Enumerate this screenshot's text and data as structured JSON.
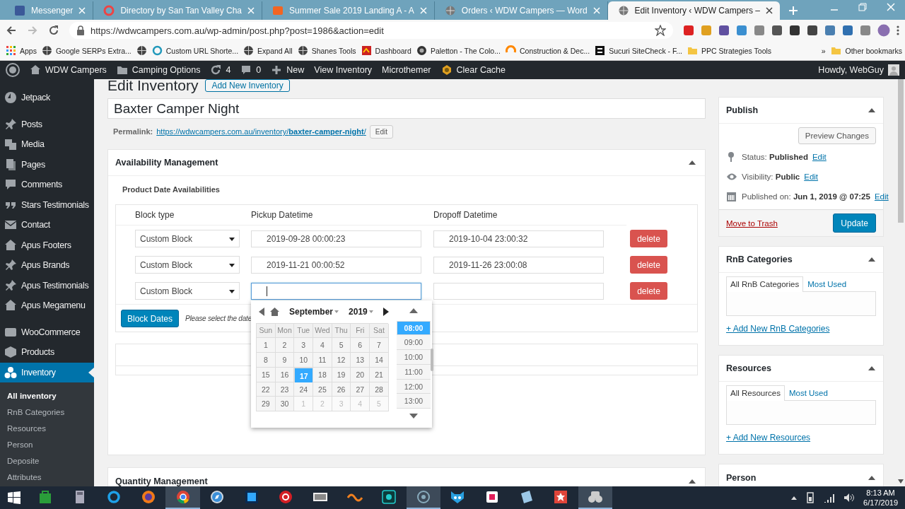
{
  "browser": {
    "tabs": [
      {
        "title": "Messenger",
        "selected": false
      },
      {
        "title": "Directory by San Tan Valley Cha",
        "selected": false
      },
      {
        "title": "Summer Sale 2019 Landing A - A",
        "selected": false
      },
      {
        "title": "Orders ‹ WDW Campers — Word",
        "selected": false
      },
      {
        "title": "Edit Inventory ‹ WDW Campers –",
        "selected": true
      }
    ],
    "url": "https://wdwcampers.com.au/wp-admin/post.php?post=1986&action=edit",
    "bookmarks": [
      {
        "kind": "link",
        "label": "Apps"
      },
      {
        "kind": "link",
        "label": "Google SERPs Extra..."
      },
      {
        "kind": "icon"
      },
      {
        "kind": "link",
        "label": "Custom URL Shorte..."
      },
      {
        "kind": "link",
        "label": "Expand All"
      },
      {
        "kind": "link",
        "label": "Shanes Tools"
      },
      {
        "kind": "link",
        "label": "Dashboard"
      },
      {
        "kind": "link",
        "label": "Paletton - The Colo..."
      },
      {
        "kind": "link",
        "label": "Construction & Dec..."
      },
      {
        "kind": "link",
        "label": "Sucuri SiteCheck - F..."
      },
      {
        "kind": "link",
        "label": "PPC Strategies Tools"
      }
    ],
    "more_bookmarks": "»",
    "other_bookmarks": "Other bookmarks"
  },
  "admin_bar": {
    "items": [
      "WDW Campers",
      "Camping Options",
      "4",
      "0",
      "New",
      "View Inventory",
      "Microthemer",
      "Clear Cache"
    ],
    "greeting": "Howdy, WebGuy"
  },
  "sidebar": {
    "menu_groups": [
      [
        {
          "label": "Jetpack",
          "selected": false
        }
      ],
      [
        {
          "label": "Posts",
          "selected": false
        },
        {
          "label": "Media",
          "selected": false
        },
        {
          "label": "Pages",
          "selected": false
        },
        {
          "label": "Comments",
          "selected": false
        },
        {
          "label": "Stars Testimonials",
          "selected": false
        },
        {
          "label": "Contact",
          "selected": false
        },
        {
          "label": "Apus Footers",
          "selected": false
        },
        {
          "label": "Apus Brands",
          "selected": false
        },
        {
          "label": "Apus Testimonials",
          "selected": false
        },
        {
          "label": "Apus Megamenu",
          "selected": false
        }
      ],
      [
        {
          "label": "WooCommerce",
          "selected": false
        },
        {
          "label": "Products",
          "selected": false
        },
        {
          "label": "Inventory",
          "selected": true
        }
      ]
    ],
    "submenu": [
      {
        "label": "All inventory",
        "selected": true
      },
      {
        "label": "RnB Categories",
        "selected": false
      },
      {
        "label": "Resources",
        "selected": false
      },
      {
        "label": "Person",
        "selected": false
      },
      {
        "label": "Deposite",
        "selected": false
      },
      {
        "label": "Attributes",
        "selected": false
      }
    ]
  },
  "editor": {
    "heading": "Edit Inventory",
    "add_new": "Add New Inventory",
    "title": "Baxter Camper Night",
    "permalink": {
      "label": "Permalink:",
      "url": "https://wdwcampers.com.au/inventory/**baxter-camper-night**/",
      "edit": "Edit"
    },
    "availability": {
      "title": "Availability Management",
      "subtitle": "Product Date Availabilities",
      "columns": [
        "Block type",
        "Pickup Datetime",
        "Dropoff Datetime"
      ],
      "rows": [
        {
          "block_type": "Custom Block",
          "pickup": "2019-09-28 00:00:23",
          "dropoff": "2019-10-04 23:00:32",
          "pickup_focused": false,
          "delete": "delete"
        },
        {
          "block_type": "Custom Block",
          "pickup": "2019-11-21 00:00:52",
          "dropoff": "2019-11-26 23:00:08",
          "pickup_focused": false,
          "delete": "delete"
        },
        {
          "block_type": "Custom Block",
          "pickup_focused": true,
          "delete": "delete"
        }
      ],
      "block_button": "Block Dates",
      "hint": "Please select the date",
      "datepicker": {
        "month": "September",
        "year": "2019",
        "weekdays": [
          "Sun",
          "Mon",
          "Tue",
          "Wed",
          "Thu",
          "Fri",
          "Sat"
        ],
        "weeks": [
          [
            {
              "day": "1",
              "selected": false,
              "other_month": false
            },
            {
              "day": "2",
              "selected": false,
              "other_month": false
            },
            {
              "day": "3",
              "selected": false,
              "other_month": false
            },
            {
              "day": "4",
              "selected": false,
              "other_month": false
            },
            {
              "day": "5",
              "selected": false,
              "other_month": false
            },
            {
              "day": "6",
              "selected": false,
              "other_month": false
            },
            {
              "day": "7",
              "selected": false,
              "other_month": false
            }
          ],
          [
            {
              "day": "8",
              "selected": false,
              "other_month": false
            },
            {
              "day": "9",
              "selected": false,
              "other_month": false
            },
            {
              "day": "10",
              "selected": false,
              "other_month": false
            },
            {
              "day": "11",
              "selected": false,
              "other_month": false
            },
            {
              "day": "12",
              "selected": false,
              "other_month": false
            },
            {
              "day": "13",
              "selected": false,
              "other_month": false
            },
            {
              "day": "14",
              "selected": false,
              "other_month": false
            }
          ],
          [
            {
              "day": "15",
              "selected": false,
              "other_month": false
            },
            {
              "day": "16",
              "selected": false,
              "other_month": false
            },
            {
              "day": "17",
              "selected": true,
              "other_month": false
            },
            {
              "day": "18",
              "selected": false,
              "other_month": false
            },
            {
              "day": "19",
              "selected": false,
              "other_month": false
            },
            {
              "day": "20",
              "selected": false,
              "other_month": false
            },
            {
              "day": "21",
              "selected": false,
              "other_month": false
            }
          ],
          [
            {
              "day": "22",
              "selected": false,
              "other_month": false
            },
            {
              "day": "23",
              "selected": false,
              "other_month": false
            },
            {
              "day": "24",
              "selected": false,
              "other_month": false
            },
            {
              "day": "25",
              "selected": false,
              "other_month": false
            },
            {
              "day": "26",
              "selected": false,
              "other_month": false
            },
            {
              "day": "27",
              "selected": false,
              "other_month": false
            },
            {
              "day": "28",
              "selected": false,
              "other_month": false
            }
          ],
          [
            {
              "day": "29",
              "selected": false,
              "other_month": false
            },
            {
              "day": "30",
              "selected": false,
              "other_month": false
            },
            {
              "day": "1",
              "selected": false,
              "other_month": true
            },
            {
              "day": "2",
              "selected": false,
              "other_month": true
            },
            {
              "day": "3",
              "selected": false,
              "other_month": true
            },
            {
              "day": "4",
              "selected": false,
              "other_month": true
            },
            {
              "day": "5",
              "selected": false,
              "other_month": true
            }
          ]
        ],
        "times": [
          {
            "label": "08:00",
            "selected": true
          },
          {
            "label": "09:00",
            "selected": false
          },
          {
            "label": "10:00",
            "selected": false
          },
          {
            "label": "11:00",
            "selected": false
          },
          {
            "label": "12:00",
            "selected": false
          },
          {
            "label": "13:00",
            "selected": false
          }
        ]
      }
    },
    "quantity": {
      "title": "Quantity Management"
    }
  },
  "side": {
    "publish": {
      "title": "Publish",
      "preview": "Preview Changes",
      "rows": [
        {
          "text": "Status: **Published**",
          "link": "Edit"
        },
        {
          "text": "Visibility: **Public**",
          "link": "Edit"
        },
        {
          "text": "Published on: **Jun 1, 2019 @ 07:25**",
          "link": "Edit"
        }
      ],
      "trash": "Move to Trash",
      "update": "Update"
    },
    "taxonomies": [
      {
        "title": "RnB Categories",
        "tabs": [
          {
            "label": "All RnB Categories",
            "selected": true
          },
          {
            "label": "Most Used",
            "selected": false
          }
        ],
        "add_link": "+ Add New RnB Categories"
      },
      {
        "title": "Resources",
        "tabs": [
          {
            "label": "All Resources",
            "selected": true
          },
          {
            "label": "Most Used",
            "selected": false
          }
        ],
        "add_link": "+ Add New Resources"
      }
    ],
    "person": {
      "title": "Person"
    }
  },
  "taskbar": {
    "apps": [
      {
        "selected": false
      },
      {
        "selected": false
      },
      {
        "selected": false
      },
      {
        "selected": false
      },
      {
        "selected": true
      },
      {
        "selected": false
      },
      {
        "selected": false
      },
      {
        "selected": false
      },
      {
        "selected": false
      },
      {
        "selected": false
      },
      {
        "selected": false
      },
      {
        "selected": true
      },
      {
        "selected": false
      },
      {
        "selected": false
      },
      {
        "selected": false
      },
      {
        "selected": false
      },
      {
        "selected": true
      }
    ],
    "time": "8:13 AM",
    "date": "6/17/2019"
  }
}
